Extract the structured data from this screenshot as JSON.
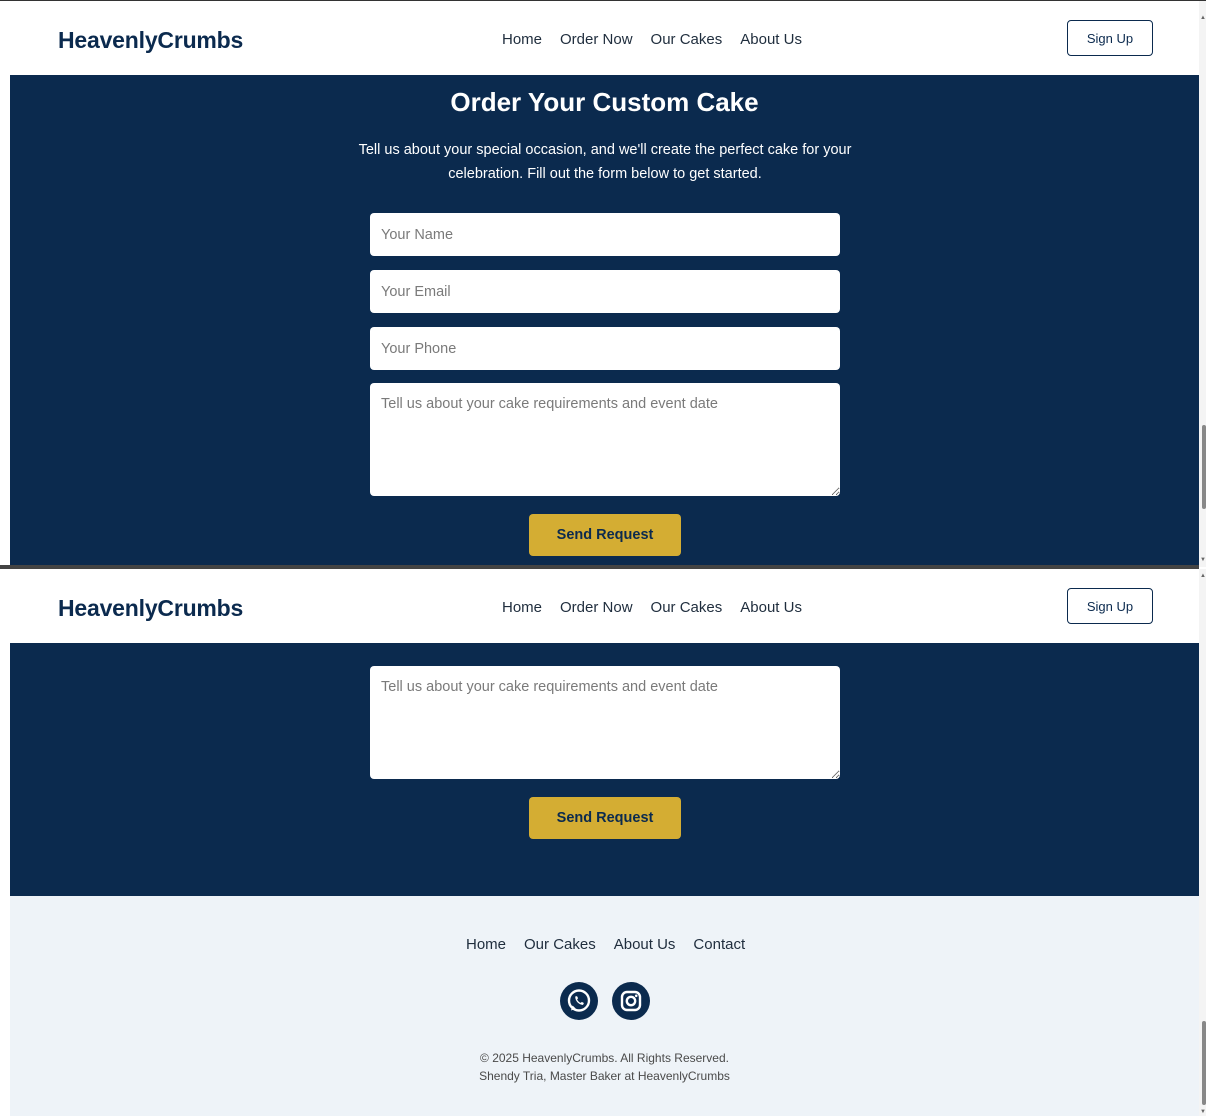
{
  "brand": "HeavenlyCrumbs",
  "nav": {
    "links": [
      "Home",
      "Order Now",
      "Our Cakes",
      "About Us"
    ],
    "signup_label": "Sign Up"
  },
  "hero": {
    "title": "Order Your Custom Cake",
    "description": "Tell us about your special occasion, and we'll create the perfect cake for your celebration. Fill out the form below to get started."
  },
  "form": {
    "name_placeholder": "Your Name",
    "email_placeholder": "Your Email",
    "phone_placeholder": "Your Phone",
    "message_placeholder": "Tell us about your cake requirements and event date",
    "submit_label": "Send Request"
  },
  "footer": {
    "links": [
      "Home",
      "Our Cakes",
      "About Us",
      "Contact"
    ],
    "social_icons": [
      "whatsapp-icon",
      "instagram-icon"
    ],
    "copyright": "© 2025 HeavenlyCrumbs. All Rights Reserved.",
    "credit": "Shendy Tria, Master Baker at HeavenlyCrumbs"
  },
  "colors": {
    "navy": "#0b2a4e",
    "gold": "#d4ad33",
    "footer_bg": "#eef3f8"
  }
}
